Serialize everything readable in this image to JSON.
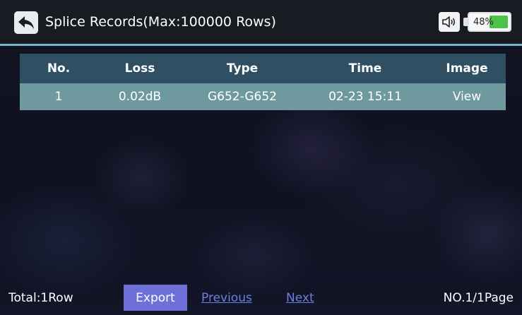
{
  "header": {
    "title": "Splice Records(Max:100000 Rows)",
    "back_icon": "back-arrow-icon",
    "sound_icon": "speaker-icon",
    "battery_percent": "48%",
    "battery_level": 0.48
  },
  "table": {
    "columns": [
      "No.",
      "Loss",
      "Type",
      "Time",
      "Image"
    ],
    "rows": [
      {
        "no": "1",
        "loss": "0.02dB",
        "type": "G652-G652",
        "time": "02-23 15:11",
        "image": "View"
      }
    ]
  },
  "footer": {
    "total": "Total:1Row",
    "export_label": "Export",
    "previous_label": "Previous",
    "next_label": "Next",
    "page_info": "NO.1/1Page"
  },
  "colors": {
    "header_bg": "#181b22",
    "accent_line": "#7fb2d0",
    "table_header_bg": "#2f4f63",
    "table_row_bg": "#6e9a9f",
    "export_bg": "#6f6fd8",
    "link": "#6b7fe0",
    "battery_fill": "#4cc24a"
  }
}
